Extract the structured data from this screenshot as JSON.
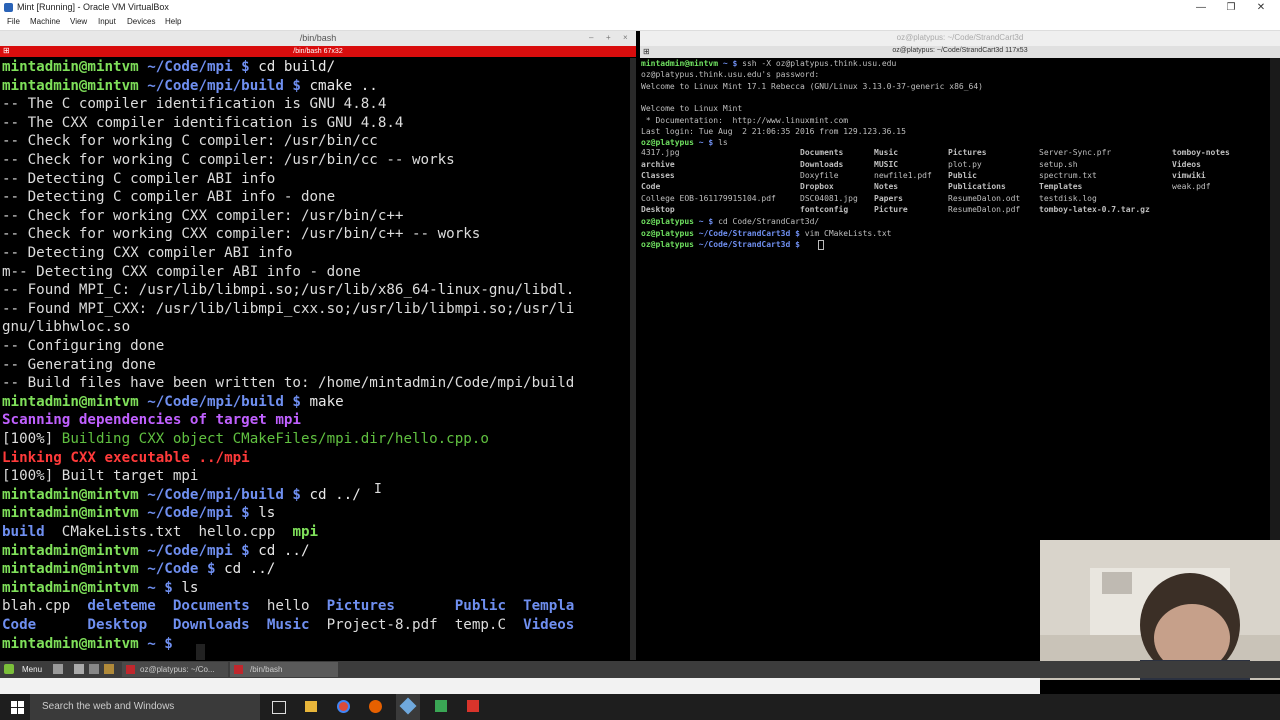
{
  "window": {
    "title": "Mint [Running] - Oracle VM VirtualBox"
  },
  "menubar": {
    "items": [
      "File",
      "Machine",
      "View",
      "Input",
      "Devices",
      "Help"
    ]
  },
  "left_terminal": {
    "title": "/bin/bash",
    "tab": "/bin/bash 67x32",
    "lines": [
      [
        {
          "t": "mintadmin@mintvm",
          "c": "g"
        },
        {
          "t": " ~/Code/mpi $",
          "c": "b"
        },
        {
          "t": " cd build/",
          "c": "cmd"
        }
      ],
      [
        {
          "t": "mintadmin@mintvm",
          "c": "g"
        },
        {
          "t": " ~/Code/mpi/build $",
          "c": "b"
        },
        {
          "t": " cmake ..",
          "c": "cmd"
        }
      ],
      [
        {
          "t": "-- The C compiler identification is GNU 4.8.4",
          "c": ""
        }
      ],
      [
        {
          "t": "-- The CXX compiler identification is GNU 4.8.4",
          "c": ""
        }
      ],
      [
        {
          "t": "-- Check for working C compiler: /usr/bin/cc",
          "c": ""
        }
      ],
      [
        {
          "t": "-- Check for working C compiler: /usr/bin/cc -- works",
          "c": ""
        }
      ],
      [
        {
          "t": "-- Detecting C compiler ABI info",
          "c": ""
        }
      ],
      [
        {
          "t": "-- Detecting C compiler ABI info - done",
          "c": ""
        }
      ],
      [
        {
          "t": "-- Check for working CXX compiler: /usr/bin/c++",
          "c": ""
        }
      ],
      [
        {
          "t": "-- Check for working CXX compiler: /usr/bin/c++ -- works",
          "c": ""
        }
      ],
      [
        {
          "t": "-- Detecting CXX compiler ABI info",
          "c": ""
        }
      ],
      [
        {
          "t": "m-- Detecting CXX compiler ABI info - done",
          "c": ""
        }
      ],
      [
        {
          "t": "-- Found MPI_C: /usr/lib/libmpi.so;/usr/lib/x86_64-linux-gnu/libdl.",
          "c": ""
        }
      ],
      [
        {
          "t": "-- Found MPI_CXX: /usr/lib/libmpi_cxx.so;/usr/lib/libmpi.so;/usr/li",
          "c": ""
        }
      ],
      [
        {
          "t": "gnu/libhwloc.so",
          "c": ""
        }
      ],
      [
        {
          "t": "-- Configuring done",
          "c": ""
        }
      ],
      [
        {
          "t": "-- Generating done",
          "c": ""
        }
      ],
      [
        {
          "t": "-- Build files have been written to: /home/mintadmin/Code/mpi/build",
          "c": ""
        }
      ],
      [
        {
          "t": "mintadmin@mintvm",
          "c": "g"
        },
        {
          "t": " ~/Code/mpi/build $",
          "c": "b"
        },
        {
          "t": " make",
          "c": "cmd"
        }
      ],
      [
        {
          "t": "Scanning dependencies of target mpi",
          "c": "mag"
        }
      ],
      [
        {
          "t": "[100%] ",
          "c": ""
        },
        {
          "t": "Building CXX object CMakeFiles/mpi.dir/hello.cpp.o",
          "c": "grn"
        }
      ],
      [
        {
          "t": "Linking CXX executable ../mpi",
          "c": "red"
        }
      ],
      [
        {
          "t": "[100%] Built target mpi",
          "c": ""
        }
      ],
      [
        {
          "t": "mintadmin@mintvm",
          "c": "g"
        },
        {
          "t": " ~/Code/mpi/build $",
          "c": "b"
        },
        {
          "t": " cd ../",
          "c": "cmd"
        }
      ],
      [
        {
          "t": "mintadmin@mintvm",
          "c": "g"
        },
        {
          "t": " ~/Code/mpi $",
          "c": "b"
        },
        {
          "t": " ls",
          "c": "cmd"
        }
      ],
      [
        {
          "t": "build",
          "c": "b"
        },
        {
          "t": "  CMakeLists.txt  hello.cpp  ",
          "c": ""
        },
        {
          "t": "mpi",
          "c": "g"
        }
      ],
      [
        {
          "t": "mintadmin@mintvm",
          "c": "g"
        },
        {
          "t": " ~/Code/mpi $",
          "c": "b"
        },
        {
          "t": " cd ../",
          "c": "cmd"
        }
      ],
      [
        {
          "t": "mintadmin@mintvm",
          "c": "g"
        },
        {
          "t": " ~/Code $",
          "c": "b"
        },
        {
          "t": " cd ../",
          "c": "cmd"
        }
      ],
      [
        {
          "t": "mintadmin@mintvm",
          "c": "g"
        },
        {
          "t": " ~ $",
          "c": "b"
        },
        {
          "t": " ls",
          "c": "cmd"
        }
      ],
      [
        {
          "t": "blah.cpp  ",
          "c": ""
        },
        {
          "t": "deleteme",
          "c": "b"
        },
        {
          "t": "  ",
          "c": ""
        },
        {
          "t": "Documents",
          "c": "b"
        },
        {
          "t": "  hello  ",
          "c": ""
        },
        {
          "t": "Pictures",
          "c": "b"
        },
        {
          "t": "       ",
          "c": ""
        },
        {
          "t": "Public",
          "c": "b"
        },
        {
          "t": "  ",
          "c": ""
        },
        {
          "t": "Templa",
          "c": "b"
        }
      ],
      [
        {
          "t": "Code",
          "c": "b"
        },
        {
          "t": "      ",
          "c": ""
        },
        {
          "t": "Desktop",
          "c": "b"
        },
        {
          "t": "   ",
          "c": ""
        },
        {
          "t": "Downloads",
          "c": "b"
        },
        {
          "t": "  ",
          "c": ""
        },
        {
          "t": "Music",
          "c": "b"
        },
        {
          "t": "  Project-8.pdf  temp.C  ",
          "c": ""
        },
        {
          "t": "Videos",
          "c": "b"
        }
      ],
      [
        {
          "t": "mintadmin@mintvm",
          "c": "g"
        },
        {
          "t": " ~ $",
          "c": "b"
        },
        {
          "t": " ",
          "c": ""
        }
      ]
    ]
  },
  "right_terminal": {
    "title": "oz@platypus: ~/Code/StrandCart3d",
    "tab": "oz@platypus: ~/Code/StrandCart3d 117x53",
    "lines_top": [
      [
        {
          "t": "mintadmin@mintvm",
          "c": "rg"
        },
        {
          "t": " ~ $",
          "c": "rb"
        },
        {
          "t": " ssh -X oz@platypus.think.usu.edu",
          "c": ""
        }
      ],
      [
        {
          "t": "oz@platypus.think.usu.edu's password:",
          "c": ""
        }
      ],
      [
        {
          "t": "Welcome to Linux Mint 17.1 Rebecca (GNU/Linux 3.13.0-37-generic x86_64)",
          "c": ""
        }
      ],
      [
        {
          "t": "",
          "c": ""
        }
      ],
      [
        {
          "t": "Welcome to Linux Mint",
          "c": ""
        }
      ],
      [
        {
          "t": " * Documentation:  http://www.linuxmint.com",
          "c": ""
        }
      ],
      [
        {
          "t": "Last login: Tue Aug  2 21:06:35 2016 from 129.123.36.15",
          "c": ""
        }
      ],
      [
        {
          "t": "oz@platypus",
          "c": "rg"
        },
        {
          "t": " ~ $",
          "c": "rb"
        },
        {
          "t": " ls",
          "c": ""
        }
      ]
    ],
    "ls_columns": [
      [
        {
          "t": "4317.jpg",
          "c": ""
        },
        {
          "t": "archive",
          "c": "rb"
        },
        {
          "t": "Classes",
          "c": "rb"
        },
        {
          "t": "Code",
          "c": "rb"
        },
        {
          "t": "College EOB-161179915104.pdf",
          "c": ""
        },
        {
          "t": "Desktop",
          "c": "rb"
        }
      ],
      [
        {
          "t": "Documents",
          "c": "rb"
        },
        {
          "t": "Downloads",
          "c": "rb"
        },
        {
          "t": "Doxyfile",
          "c": ""
        },
        {
          "t": "Dropbox",
          "c": "rb"
        },
        {
          "t": "DSC04081.jpg",
          "c": ""
        },
        {
          "t": "fontconfig",
          "c": "rb"
        }
      ],
      [
        {
          "t": "Music",
          "c": "rb"
        },
        {
          "t": "MUSIC",
          "c": "rb"
        },
        {
          "t": "newfile1.pdf",
          "c": ""
        },
        {
          "t": "Notes",
          "c": "rb"
        },
        {
          "t": "Papers",
          "c": "rb"
        },
        {
          "t": "Picture",
          "c": "rb"
        }
      ],
      [
        {
          "t": "Pictures",
          "c": "rb"
        },
        {
          "t": "plot.py",
          "c": ""
        },
        {
          "t": "Public",
          "c": "rb"
        },
        {
          "t": "Publications",
          "c": "rb"
        },
        {
          "t": "ResumeDalon.odt",
          "c": ""
        },
        {
          "t": "ResumeDalon.pdf",
          "c": ""
        }
      ],
      [
        {
          "t": "Server-Sync.pfr",
          "c": ""
        },
        {
          "t": "setup.sh",
          "c": ""
        },
        {
          "t": "spectrum.txt",
          "c": ""
        },
        {
          "t": "Templates",
          "c": "rb"
        },
        {
          "t": "testdisk.log",
          "c": ""
        },
        {
          "t": "tomboy-latex-0.7.tar.gz",
          "c": "rred"
        }
      ],
      [
        {
          "t": "tomboy-notes",
          "c": "rb"
        },
        {
          "t": "Videos",
          "c": "rb"
        },
        {
          "t": "vimwiki",
          "c": "rb"
        },
        {
          "t": "weak.pdf",
          "c": ""
        },
        {
          "t": "",
          "c": ""
        },
        {
          "t": "",
          "c": ""
        }
      ]
    ],
    "lines_bottom": [
      [
        {
          "t": "oz@platypus",
          "c": "rg"
        },
        {
          "t": " ~ $",
          "c": "rb"
        },
        {
          "t": " cd Code/StrandCart3d/",
          "c": ""
        }
      ],
      [
        {
          "t": "oz@platypus",
          "c": "rg"
        },
        {
          "t": " ~/Code/StrandCart3d $",
          "c": "rb"
        },
        {
          "t": " vim CMakeLists.txt",
          "c": ""
        }
      ],
      [
        {
          "t": "oz@platypus",
          "c": "rg"
        },
        {
          "t": " ~/Code/StrandCart3d $",
          "c": "rb"
        },
        {
          "t": " ",
          "c": ""
        }
      ]
    ]
  },
  "guest_panel": {
    "menu_label": "Menu",
    "tasks": [
      "oz@platypus: ~/Co...",
      "/bin/bash"
    ]
  },
  "taskbar": {
    "search_placeholder": "Search the web and Windows"
  }
}
